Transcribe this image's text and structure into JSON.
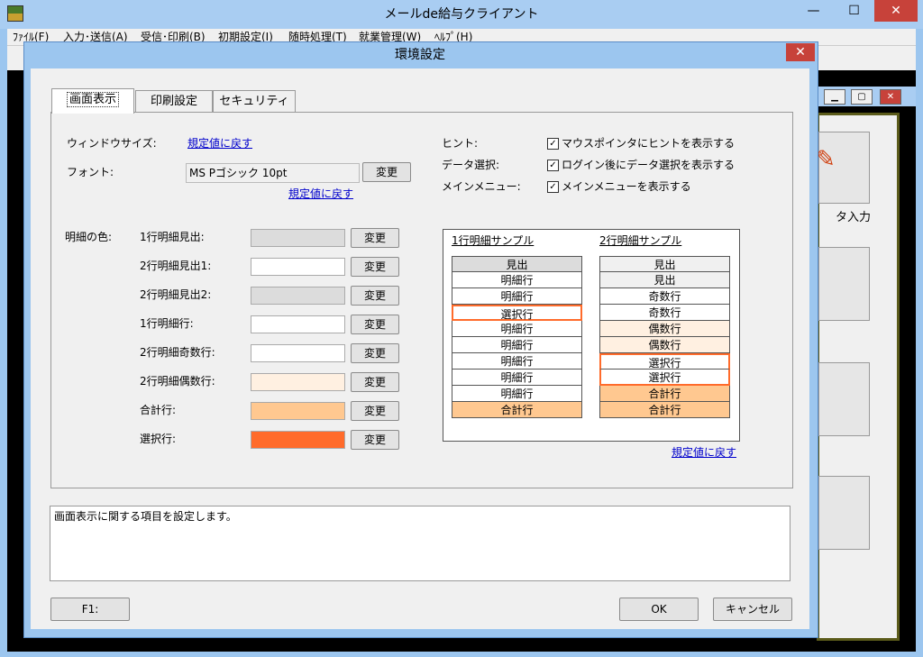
{
  "main": {
    "title": "メールde給与クライアント",
    "menu": [
      "ﾌｧｲﾙ(F)",
      "入力･送信(A)",
      "受信･印刷(B)",
      "初期設定(I)",
      "随時処理(T)",
      "就業管理(W)",
      "ﾍﾙﾌﾟ(H)"
    ],
    "bg_button_label": "タ入力"
  },
  "dialog": {
    "title": "環境設定",
    "tabs": [
      "画面表示",
      "印刷設定",
      "セキュリティ"
    ],
    "window_size_label": "ウィンドウサイズ:",
    "reset_link": "規定値に戻す",
    "font_label": "フォント:",
    "font_value": "MS Pゴシック 10pt",
    "change_label": "変更",
    "hint_label": "ヒント:",
    "hint_check": "マウスポインタにヒントを表示する",
    "data_select_label": "データ選択:",
    "data_select_check": "ログイン後にデータ選択を表示する",
    "main_menu_label": "メインメニュー:",
    "main_menu_check": "メインメニューを表示する",
    "detail_color_label": "明細の色:",
    "color_rows": [
      {
        "label": "1行明細見出:",
        "color": "#dcdcdc"
      },
      {
        "label": "2行明細見出1:",
        "color": "#ffffff"
      },
      {
        "label": "2行明細見出2:",
        "color": "#dcdcdc"
      },
      {
        "label": "1行明細行:",
        "color": "#ffffff"
      },
      {
        "label": "2行明細奇数行:",
        "color": "#ffffff"
      },
      {
        "label": "2行明細偶数行:",
        "color": "#fff0e1"
      },
      {
        "label": "合計行:",
        "color": "#ffc890"
      },
      {
        "label": "選択行:",
        "color": "#ff6b2b"
      }
    ],
    "sample1_title": "1行明細サンプル",
    "sample2_title": "2行明細サンプル",
    "sample1_rows": [
      "見出",
      "明細行",
      "明細行",
      "選択行",
      "明細行",
      "明細行",
      "明細行",
      "明細行",
      "明細行",
      "合計行"
    ],
    "sample2_rows": [
      "見出",
      "見出",
      "奇数行",
      "奇数行",
      "偶数行",
      "偶数行",
      "選択行",
      "選択行",
      "合計行",
      "合計行"
    ],
    "description": "画面表示に関する項目を設定します。",
    "f1_label": "F1:",
    "ok_label": "OK",
    "cancel_label": "キャンセル"
  },
  "colors": {
    "header_gray": "#dcdcdc",
    "even_row": "#fff0e1",
    "total_row": "#ffc890",
    "selected_border": "#ff6b2b",
    "title_bar": "#a9cdf2",
    "close_red": "#c7423a"
  }
}
